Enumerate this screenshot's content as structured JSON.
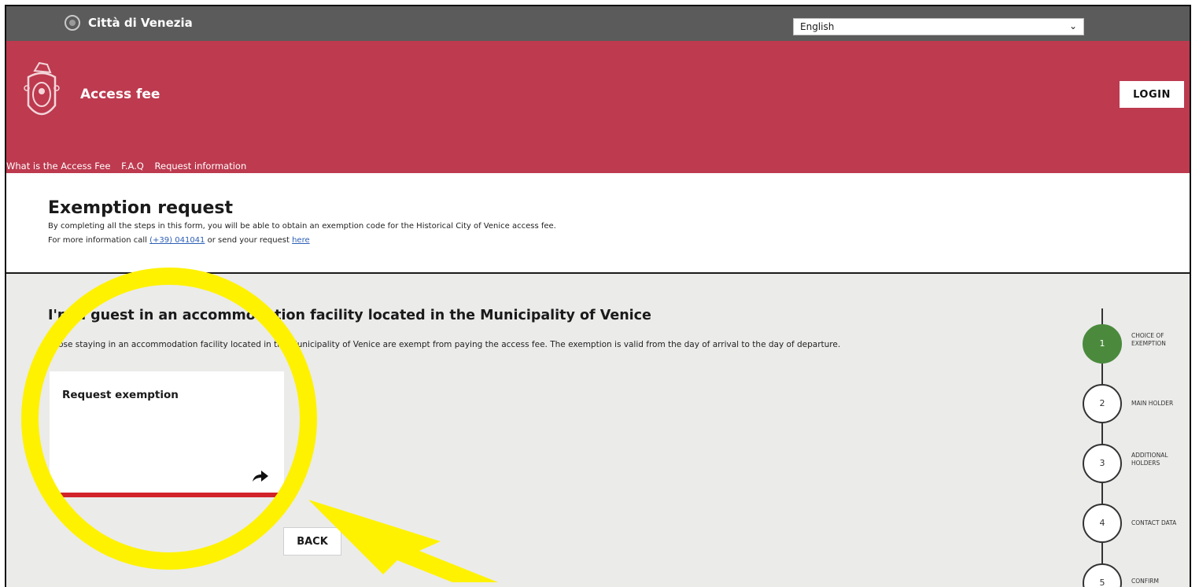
{
  "topbar": {
    "city_name": "Città di Venezia",
    "language_selected": "English"
  },
  "header": {
    "app_title": "Access fee",
    "login_label": "LOGIN",
    "nav": [
      "What is the Access Fee",
      "F.A.Q",
      "Request information"
    ]
  },
  "intro": {
    "title": "Exemption request",
    "line1": "By completing all the steps in this form, you will be able to obtain an exemption code for the Historical City of Venice access fee.",
    "line2_prefix": "For more information call ",
    "phone": "(+39) 041041",
    "line2_middle": " or send your request ",
    "link_here": "here"
  },
  "section": {
    "title": "I'm a guest in an accommodation facility located in the Municipality of Venice",
    "description": "Those staying in an accommodation facility located in the Municipality of Venice are exempt from paying the access fee. The exemption is valid from the day of arrival to the day of departure.",
    "card_title": "Request exemption",
    "card_icon": "share-arrow-icon",
    "back_label": "BACK"
  },
  "stepper": {
    "active_step": 1,
    "steps": [
      {
        "number": "1",
        "label_line1": "CHOICE OF",
        "label_line2": "EXEMPTION"
      },
      {
        "number": "2",
        "label_line1": "MAIN HOLDER",
        "label_line2": ""
      },
      {
        "number": "3",
        "label_line1": "ADDITIONAL",
        "label_line2": "HOLDERS"
      },
      {
        "number": "4",
        "label_line1": "CONTACT DATA",
        "label_line2": ""
      },
      {
        "number": "5",
        "label_line1": "CONFIRM",
        "label_line2": ""
      }
    ]
  },
  "annotation": {
    "highlight_color": "#fff200"
  }
}
